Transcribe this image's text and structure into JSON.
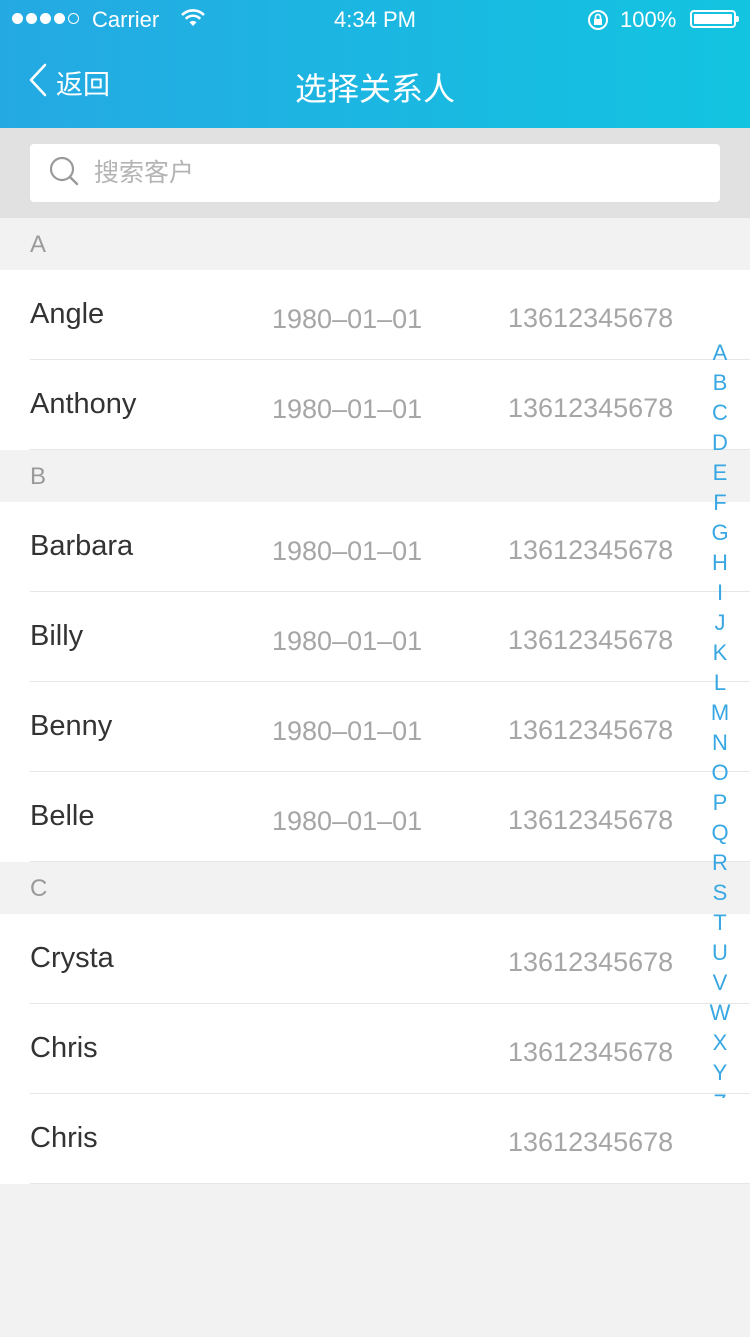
{
  "status_bar": {
    "carrier": "Carrier",
    "time": "4:34 PM",
    "battery": "100%"
  },
  "nav": {
    "back_label": "返回",
    "title": "选择关系人"
  },
  "search": {
    "placeholder": "搜索客户",
    "value": ""
  },
  "sections": [
    {
      "letter": "A",
      "contacts": [
        {
          "name": "Angle",
          "date": "1980–01–01",
          "phone": "13612345678"
        },
        {
          "name": "Anthony",
          "date": "1980–01–01",
          "phone": "13612345678"
        }
      ]
    },
    {
      "letter": "B",
      "contacts": [
        {
          "name": "Barbara",
          "date": "1980–01–01",
          "phone": "13612345678"
        },
        {
          "name": "Billy",
          "date": "1980–01–01",
          "phone": "13612345678"
        },
        {
          "name": "Benny",
          "date": "1980–01–01",
          "phone": "13612345678"
        },
        {
          "name": "Belle",
          "date": "1980–01–01",
          "phone": "13612345678"
        }
      ]
    },
    {
      "letter": "C",
      "contacts": [
        {
          "name": "Crysta",
          "date": "",
          "phone": "13612345678"
        },
        {
          "name": "Chris",
          "date": "",
          "phone": "13612345678"
        },
        {
          "name": "Chris",
          "date": "",
          "phone": "13612345678"
        }
      ]
    }
  ],
  "index_letters": [
    "A",
    "B",
    "C",
    "D",
    "E",
    "F",
    "G",
    "H",
    "I",
    "J",
    "K",
    "L",
    "M",
    "N",
    "O",
    "P",
    "Q",
    "R",
    "S",
    "T",
    "U",
    "V",
    "W",
    "X",
    "Y",
    "Z",
    "#"
  ],
  "colors": {
    "header_start": "#25a9e3",
    "header_end": "#12c4e0",
    "index_accent": "#38a7e2"
  },
  "icons": {
    "back": "chevron-left-icon",
    "search": "search-icon",
    "wifi": "wifi-icon",
    "lock": "rotation-lock-icon"
  }
}
